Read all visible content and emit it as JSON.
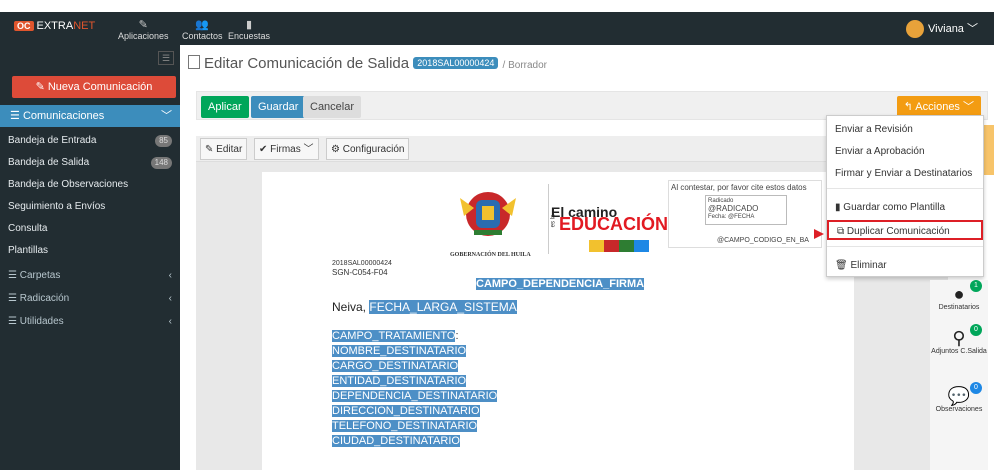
{
  "topbar": {
    "brand_logo": "OC",
    "brand_a": "EXTRA",
    "brand_b": "NET",
    "nav": [
      {
        "label": "Aplicaciones",
        "icon": "wand-icon"
      },
      {
        "label": "Contactos",
        "icon": "users-icon"
      },
      {
        "label": "Encuestas",
        "icon": "file-icon"
      }
    ],
    "user": "Viviana"
  },
  "sidebar": {
    "new_button": "Nueva Comunicación",
    "section": "Comunicaciones",
    "items": [
      {
        "label": "Bandeja de Entrada",
        "badge": "85"
      },
      {
        "label": "Bandeja de Salida",
        "badge": "148"
      },
      {
        "label": "Bandeja de Observaciones",
        "badge": ""
      },
      {
        "label": "Seguimiento a Envíos",
        "badge": ""
      },
      {
        "label": "Consulta",
        "badge": ""
      },
      {
        "label": "Plantillas",
        "badge": ""
      }
    ],
    "groups": [
      "Carpetas",
      "Radicación",
      "Utilidades"
    ]
  },
  "main": {
    "title": "Editar Comunicación de Salida",
    "id_badge": "2018SAL00000424",
    "crumb": "/ Borrador",
    "buttons": {
      "apply": "Aplicar",
      "save": "Guardar",
      "cancel": "Cancelar",
      "actions": "Acciones"
    },
    "editor": {
      "edit": "Editar",
      "signatures": "Firmas",
      "config": "Configuración"
    }
  },
  "document": {
    "gob_label": "GOBERNACIÓN DEL HUILA",
    "camino_1": "El camino",
    "camino_2": "EDUCACIÓN",
    "camino_vert": "es la",
    "cite_note": "Al contestar, por favor cite estos datos",
    "rad_label": "Radicado",
    "rad_value": "@RADICADO",
    "rad_fecha": "Fecha:   @FECHA",
    "codigo": "@CAMPO_CODIGO_EN_BA",
    "num": "2018SAL00000424",
    "sgn": "SGN-C054-F04",
    "dep_field": "CAMPO_DEPENDENCIA_FIRMA",
    "city": "Neiva, ",
    "date_field": "FECHA_LARGA_SISTEMA",
    "treatment": "CAMPO_TRATAMIENTO",
    "treatment_suffix": ":",
    "dest_fields": [
      "NOMBRE_DESTINATARIO",
      "CARGO_DESTINATARIO",
      "ENTIDAD_DESTINATARIO",
      "DEPENDENCIA_DESTINATARIO",
      "DIRECCION_DESTINATARIO",
      "TELEFONO_DESTINATARIO",
      "CIUDAD_DESTINATARIO"
    ]
  },
  "actions_menu": {
    "items": [
      "Enviar a Revisión",
      "Enviar a Aprobación",
      "Firmar y Enviar a Destinatarios",
      "Guardar como Plantilla",
      "Duplicar Comunicación",
      "Eliminar"
    ]
  },
  "right_panel": {
    "destinatarios": {
      "label": "Destinatarios",
      "count": "1"
    },
    "adjuntos": {
      "label": "Adjuntos C.Salida",
      "count": "0"
    },
    "observaciones": {
      "label": "Observaciones",
      "count": "0"
    }
  }
}
